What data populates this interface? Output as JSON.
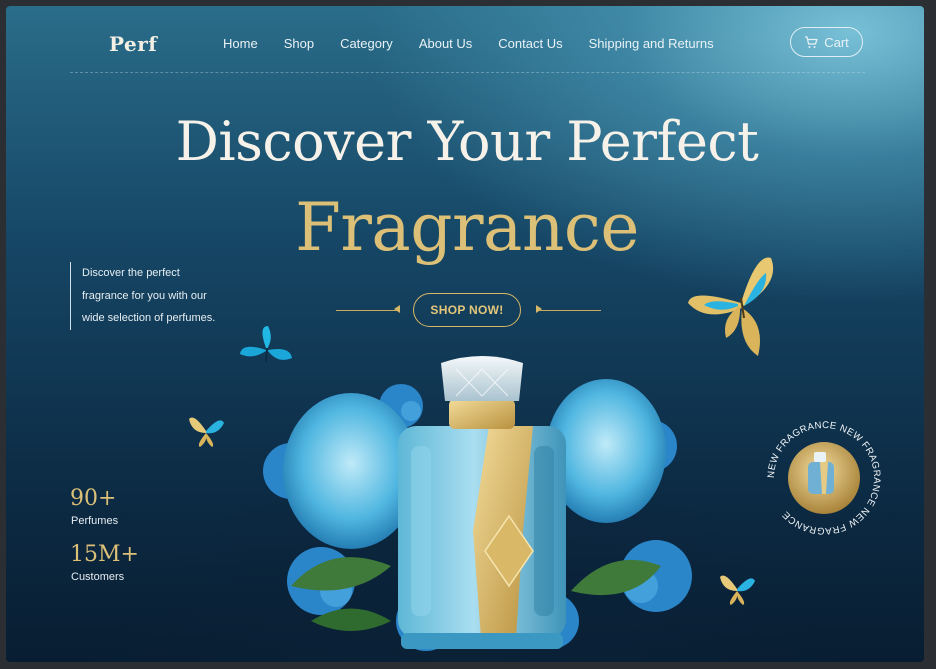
{
  "brand": {
    "logo": "Perf"
  },
  "nav": {
    "links": [
      "Home",
      "Shop",
      "Category",
      "About Us",
      "Contact Us",
      "Shipping and Returns"
    ],
    "cart_label": "Cart"
  },
  "hero": {
    "title_line1": "Discover Your Perfect",
    "title_line2": "Fragrance",
    "description_lines": [
      "Discover the perfect",
      "fragrance for you with our",
      "wide selection of perfumes."
    ],
    "cta_label": "SHOP NOW!"
  },
  "stats": [
    {
      "value": "90+",
      "label": "Perfumes"
    },
    {
      "value": "15M+",
      "label": "Customers"
    }
  ],
  "badge": {
    "ring_text": "NEW FRAGRANCE NEW FRAGRANCE NEW FRAGRANCE "
  },
  "icons": {
    "cart": "cart-icon",
    "arrows": [
      "arrow-left-icon",
      "arrow-right-icon"
    ]
  },
  "colors": {
    "gold": "#dcc078",
    "teal": "#164766",
    "cream": "#f6f2ea"
  }
}
